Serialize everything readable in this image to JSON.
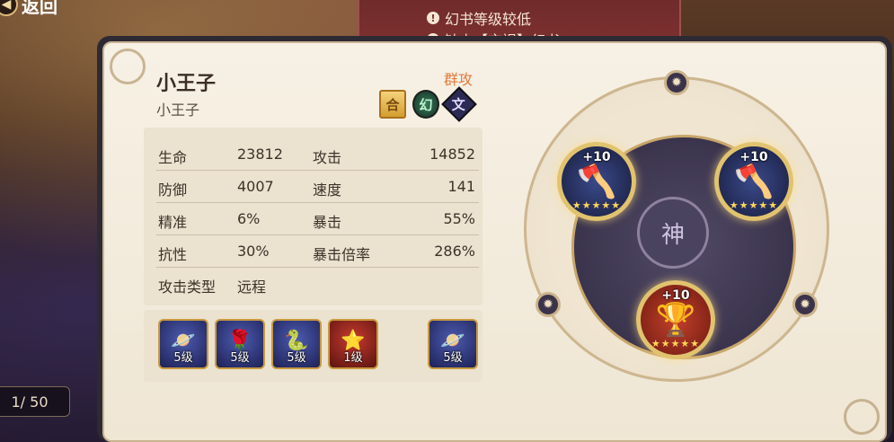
{
  "top": {
    "back_label": "返回",
    "warnings": [
      "幻书等级较低",
      "缺少【灾祸】幻书"
    ],
    "counter": "1/ 50"
  },
  "character": {
    "name": "小王子",
    "subname": "小王子",
    "attack_type_tag": "群攻",
    "badges": {
      "card": "合",
      "element": "幻",
      "class": "文"
    }
  },
  "stats": [
    {
      "label": "生命",
      "value": "23812",
      "label2": "攻击",
      "value2": "14852"
    },
    {
      "label": "防御",
      "value": "4007",
      "label2": "速度",
      "value2": "141"
    },
    {
      "label": "精准",
      "value": "6%",
      "label2": "暴击",
      "value2": "55%"
    },
    {
      "label": "抗性",
      "value": "30%",
      "label2": "暴击倍率",
      "value2": "286%"
    },
    {
      "label": "攻击类型",
      "value": "远程"
    }
  ],
  "skills": [
    {
      "level": "5级"
    },
    {
      "level": "5级"
    },
    {
      "level": "5级"
    },
    {
      "level": "1级"
    },
    {
      "level": "5级"
    }
  ],
  "wheel": {
    "core_label": "神",
    "slots": [
      {
        "plus": "+10",
        "stars": "★★★★★"
      },
      {
        "plus": "+10",
        "stars": "★★★★★"
      },
      {
        "plus": "+10",
        "stars": "★★★★★"
      }
    ]
  }
}
